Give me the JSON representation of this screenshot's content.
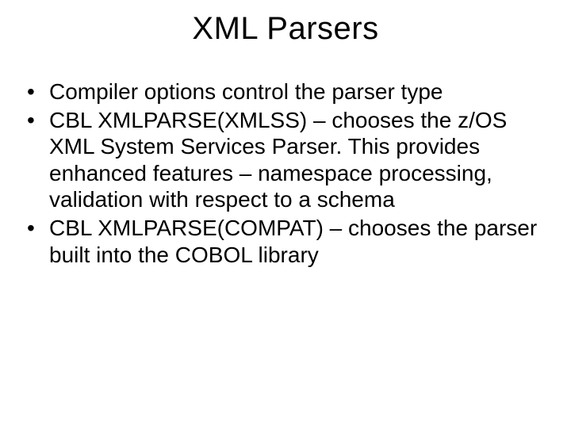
{
  "slide": {
    "title": "XML Parsers",
    "bullets": [
      "Compiler options control the parser type",
      "CBL  XMLPARSE(XMLSS) – chooses the z/OS XML System Services Parser.  This provides enhanced features – namespace processing, validation with respect to a schema",
      "CBL  XMLPARSE(COMPAT) – chooses the parser built into the COBOL library"
    ]
  }
}
